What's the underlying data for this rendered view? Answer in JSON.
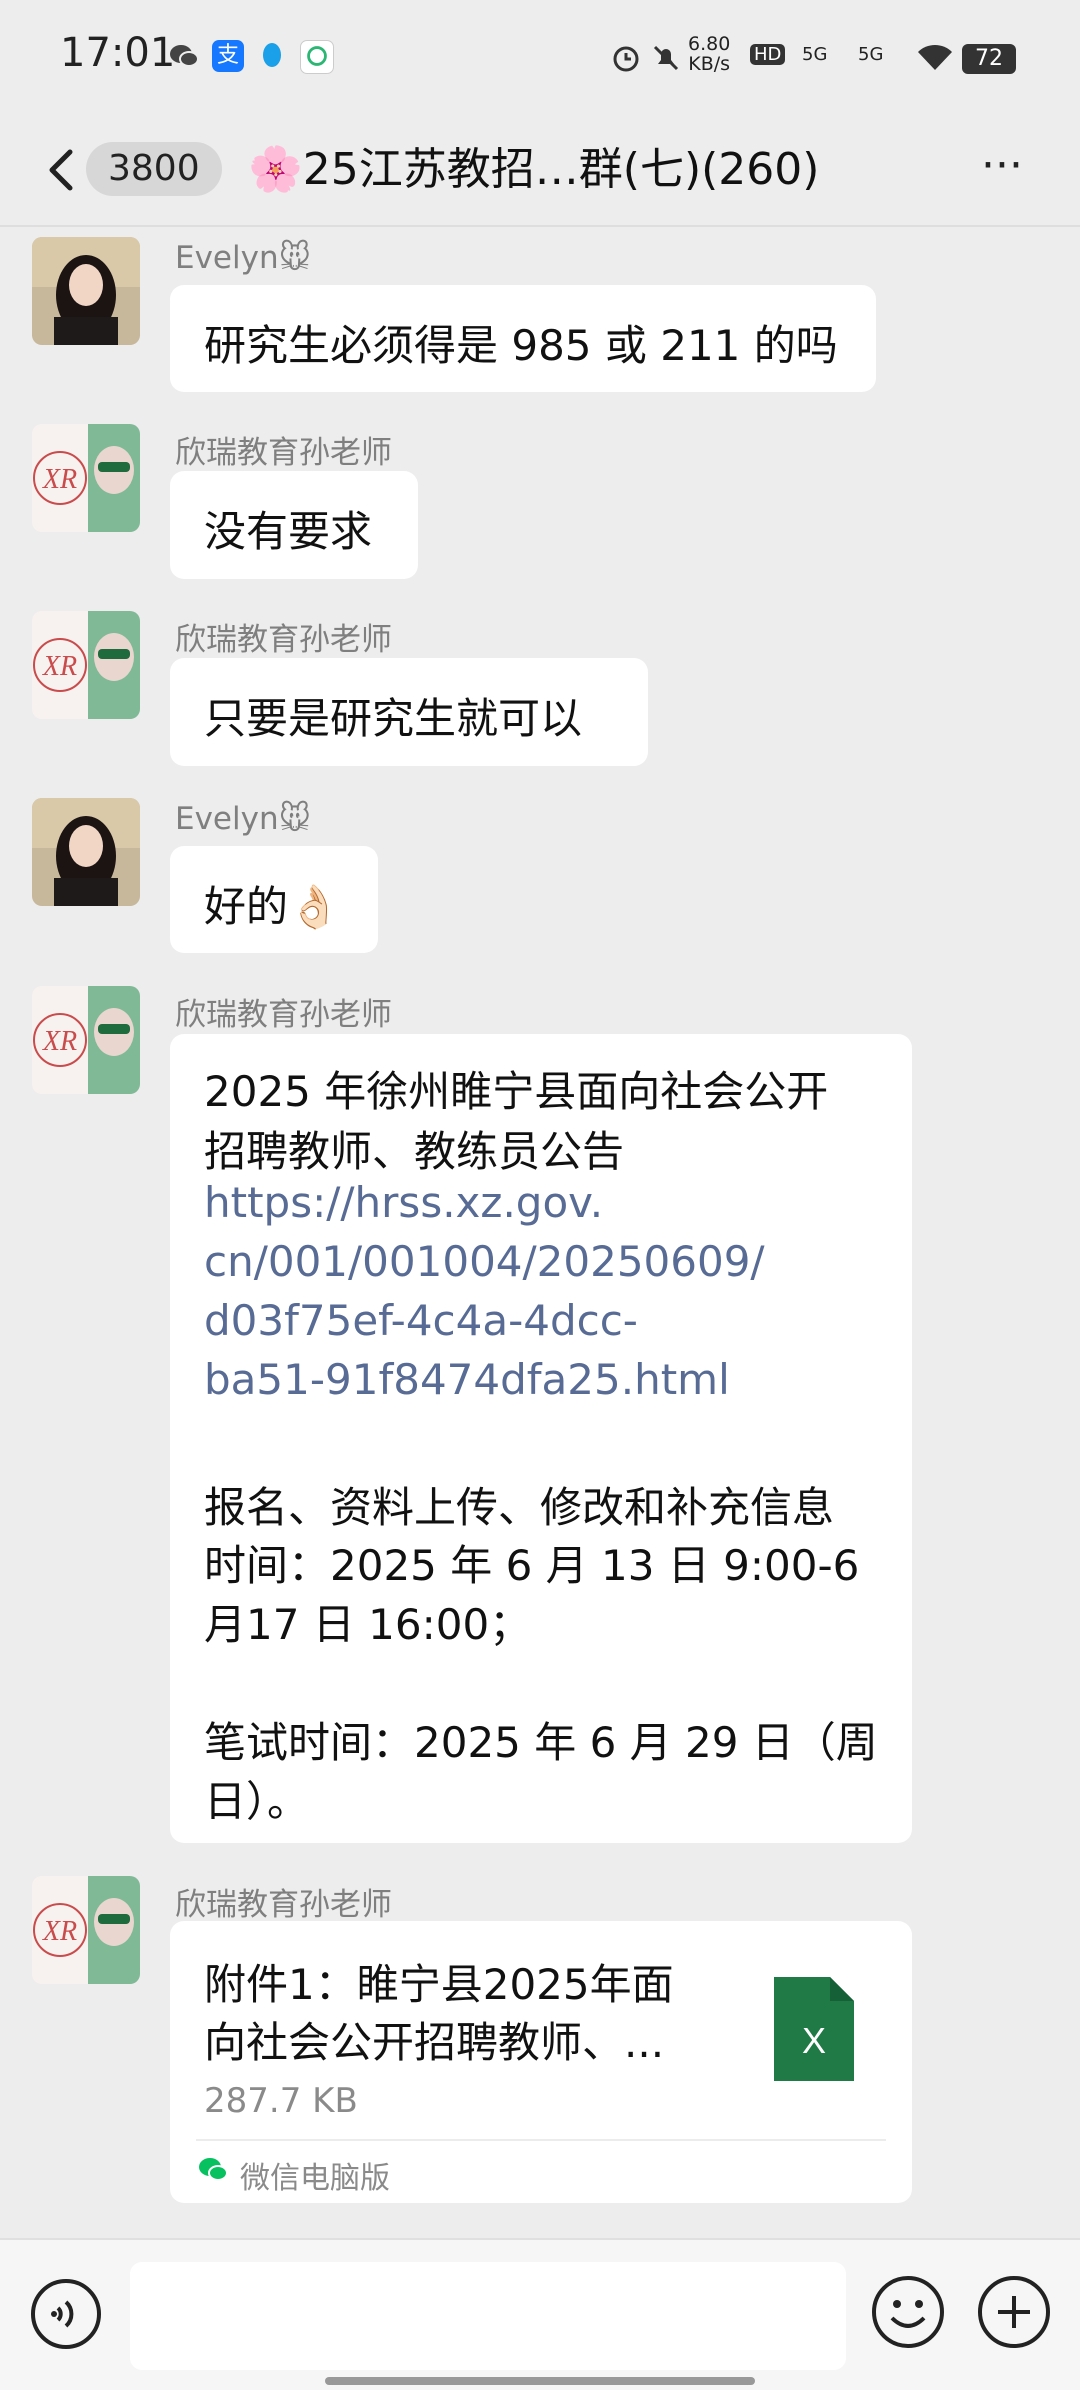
{
  "status_bar": {
    "time": "17:01",
    "net_speed_value": "6.80",
    "net_speed_unit": "KB/s",
    "hd_label": "HD",
    "signal_1": "5G",
    "signal_2": "5G",
    "battery": "72",
    "alipay_label": "支"
  },
  "header": {
    "unread_count": "3800",
    "title": "🌸25江苏教招…群(七)(260)",
    "more_label": "···"
  },
  "messages": [
    {
      "sender": "Evelyn🐭",
      "avatar": "avatar-photo",
      "text": "研究生必须得是 985 或 211 的吗"
    },
    {
      "sender": "欣瑞教育孙老师",
      "avatar": "avatar-xr",
      "text": "没有要求"
    },
    {
      "sender": "欣瑞教育孙老师",
      "avatar": "avatar-xr",
      "text": "只要是研究生就可以"
    },
    {
      "sender": "Evelyn🐭",
      "avatar": "avatar-photo",
      "text": "好的👌🏻"
    },
    {
      "sender": "欣瑞教育孙老师",
      "avatar": "avatar-xr",
      "lines": [
        "2025 年徐州睢宁县面向社会公开",
        "招聘教师、教练员公告",
        "https://hrss.xz.gov.",
        "cn/001/001004/20250609/",
        "d03f75ef-4c4a-4dcc-",
        "ba51-91f8474dfa25.html",
        "报名、资料上传、修改和补充信息",
        "时间：2025 年 6 月 13 日 9:00-6",
        "月17 日 16:00；",
        "笔试时间：2025 年 6 月 29 日（周",
        "日）。"
      ]
    },
    {
      "sender": "欣瑞教育孙老师",
      "avatar": "avatar-xr",
      "file": {
        "name_line1": "附件1：睢宁县2025年面",
        "name_line2": "向社会公开招聘教师、...",
        "size": "287.7 KB",
        "icon_letter": "X",
        "source": "微信电脑版"
      }
    }
  ],
  "avatar_xr_letters": "XR",
  "colors": {
    "background": "#ededed",
    "bubble": "#ffffff",
    "link": "#576b95",
    "excel_green": "#1f7a45",
    "wechat_green": "#07c160"
  }
}
